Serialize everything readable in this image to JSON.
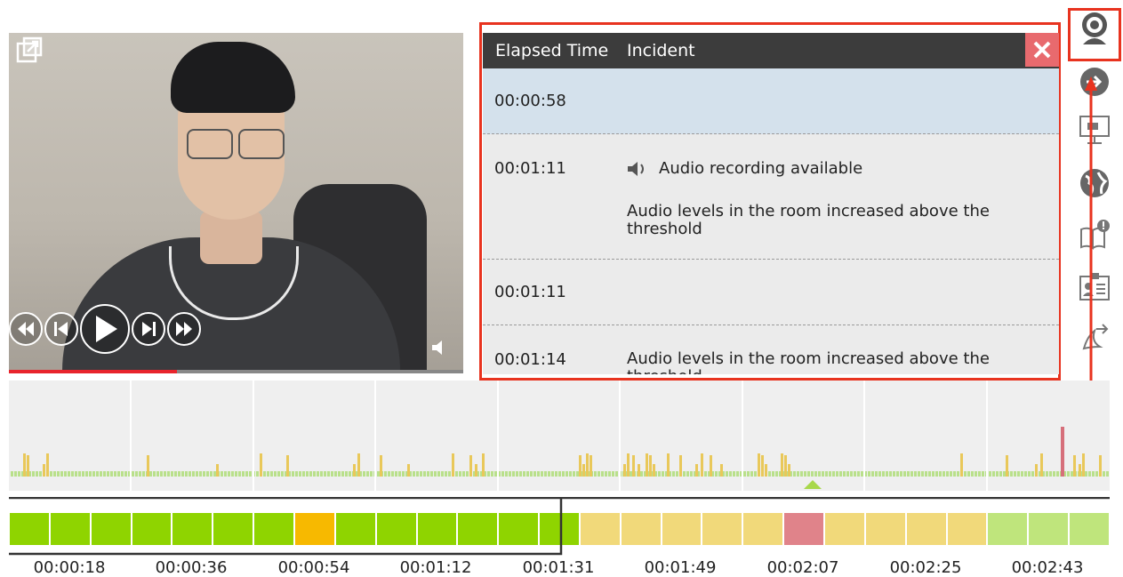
{
  "video": {
    "progress_fraction": 0.37
  },
  "incident_panel": {
    "columns": {
      "time": "Elapsed Time",
      "incident": "Incident"
    },
    "rows": [
      {
        "time": "00:00:58",
        "audio": "",
        "desc": "",
        "selected": true
      },
      {
        "time": "00:01:11",
        "audio": "Audio recording available",
        "desc": "Audio levels in the room increased above the threshold",
        "selected": false
      },
      {
        "time": "00:01:11",
        "audio": "",
        "desc": "",
        "selected": false
      },
      {
        "time": "00:01:14",
        "audio": "",
        "desc": "Audio levels in the room increased above the threshold",
        "selected": false
      }
    ]
  },
  "toolbar": {
    "icons": [
      "webcam-icon",
      "share-arrow-icon",
      "screen-icon",
      "globe-icon",
      "book-alert-icon",
      "id-card-icon",
      "document-share-icon"
    ]
  },
  "timeline": {
    "tick_labels": [
      "00:00:18",
      "00:00:36",
      "00:00:54",
      "00:01:12",
      "00:01:31",
      "00:01:49",
      "00:02:07",
      "00:02:25",
      "00:02:43"
    ],
    "status_blocks": [
      "green",
      "green",
      "green",
      "green",
      "green",
      "green",
      "green",
      "orange",
      "green",
      "green",
      "green",
      "green",
      "green",
      "green",
      "yellow",
      "yellow",
      "yellow",
      "yellow",
      "yellow",
      "red",
      "yellow",
      "yellow",
      "yellow",
      "yellow",
      "lightgreen",
      "lightgreen",
      "lightgreen"
    ],
    "colors": {
      "green": "#8fd400",
      "orange": "#f7b900",
      "yellow": "#f1d97a",
      "red": "#e0838a",
      "lightgreen": "#bfe57c",
      "bar_yellow": "#e9c85a",
      "bar_red": "#d66f7a",
      "bar_green": "#b9e08b",
      "accent_red": "#e8331f"
    }
  }
}
